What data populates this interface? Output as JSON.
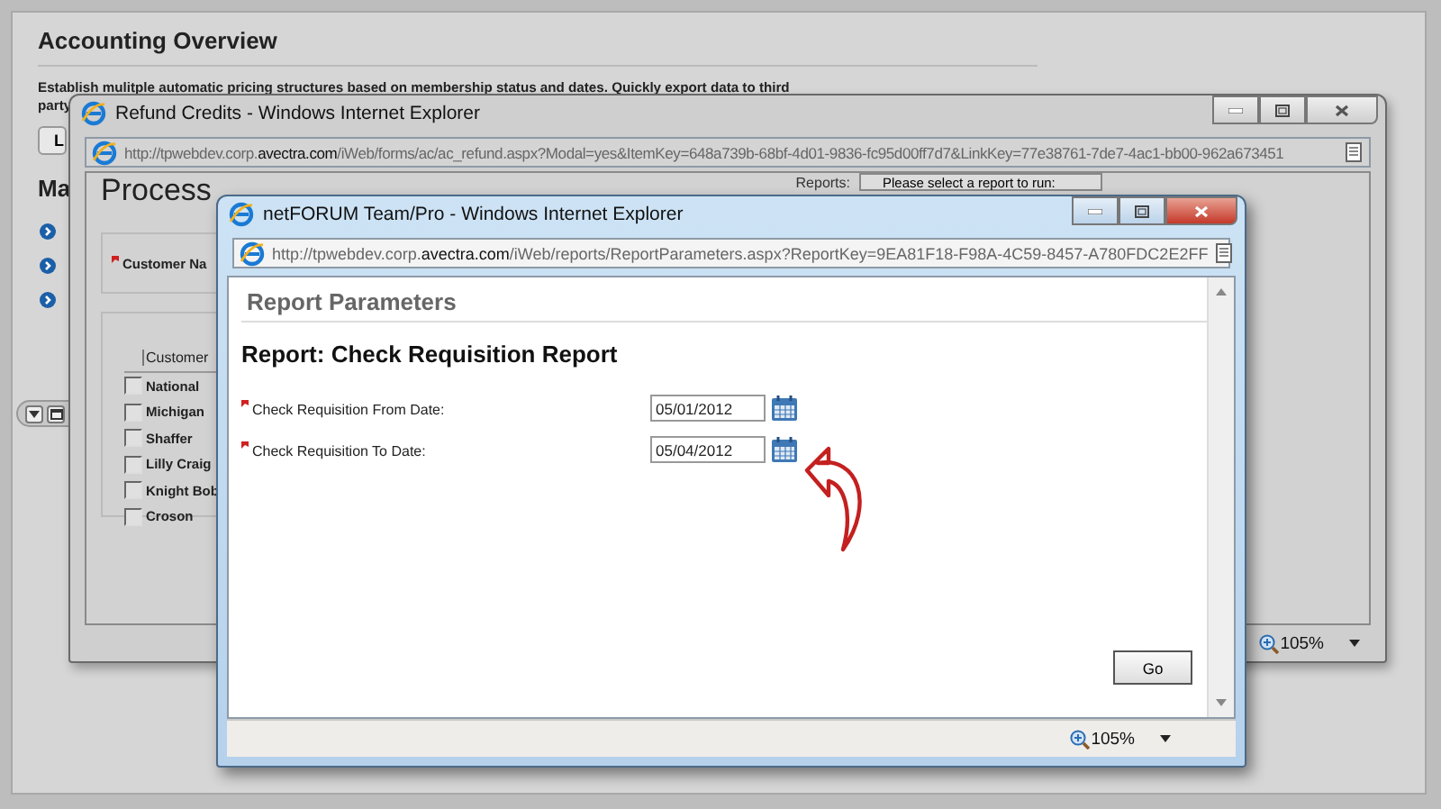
{
  "background_page": {
    "title": "Accounting Overview",
    "description": "Establish mulitple automatic pricing structures based on membership status and dates. Quickly export data to third",
    "description_cut": "party",
    "button": "L",
    "section_heading": "Ma"
  },
  "refund_window": {
    "title": "Refund Credits - Windows Internet Explorer",
    "active": false,
    "url": "http://tpwebdev.corp.**avectra.com**/iWeb/forms/ac/ac_refund.aspx?Modal=yes&ItemKey=648a739b-68bf-4d01-9836-fc95d00ff7d7&LinkKey=77e38761-7de7-4ac1-bb00-962a673451",
    "heading": "Process",
    "reports_label": "Reports:",
    "reports_select": "Please select a report to run:",
    "customer_label": "Customer Na",
    "customer_required": true,
    "table": {
      "columns": [
        "Customer"
      ],
      "rows": [
        {
          "name": "National",
          "checked": false
        },
        {
          "name": "Michigan",
          "checked": false
        },
        {
          "name": "Shaffer",
          "checked": false
        },
        {
          "name": "Lilly Craig",
          "checked": false
        },
        {
          "name": "Knight Bob",
          "checked": false
        },
        {
          "name": "Croson",
          "checked": false
        }
      ]
    },
    "zoom": "105%"
  },
  "report_window": {
    "title": "netFORUM Team/Pro - Windows Internet Explorer",
    "active": true,
    "url": "http://tpwebdev.corp.**avectra.com**/iWeb/reports/ReportParameters.aspx?ReportKey=9EA81F18-F98A-4C59-8457-A780FDC2E2FF",
    "section_title": "Report Parameters",
    "report_title": "Report: Check Requisition Report",
    "fields": [
      {
        "label": "Check Requisition From Date:",
        "value": "05/01/2012",
        "required": true
      },
      {
        "label": "Check Requisition To Date:",
        "value": "05/04/2012",
        "required": true
      }
    ],
    "go_button": "Go",
    "zoom": "105%"
  }
}
